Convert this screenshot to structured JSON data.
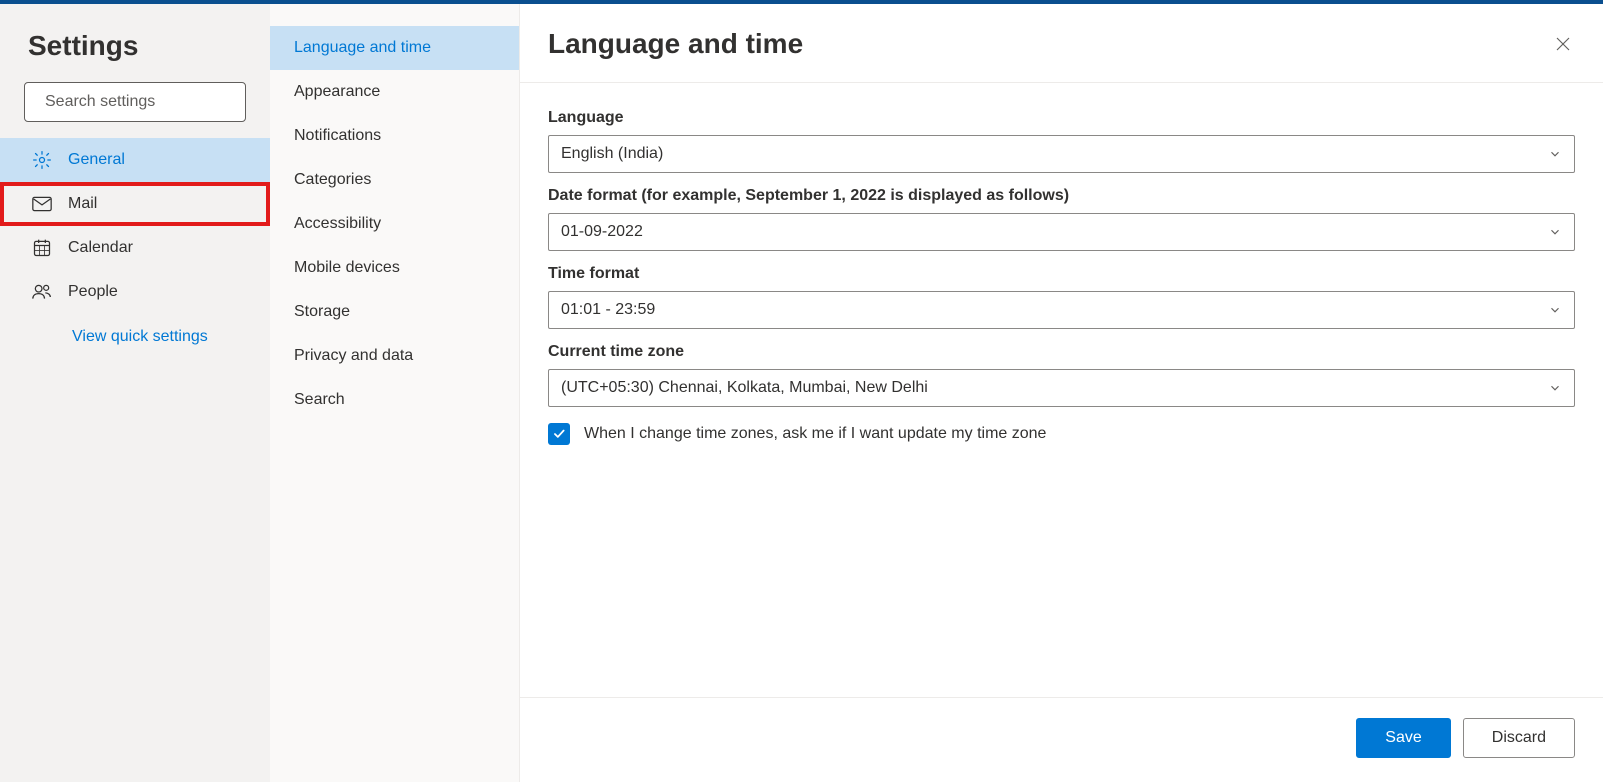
{
  "sidebar": {
    "title": "Settings",
    "search_placeholder": "Search settings",
    "items": [
      {
        "label": "General"
      },
      {
        "label": "Mail"
      },
      {
        "label": "Calendar"
      },
      {
        "label": "People"
      }
    ],
    "quick_link": "View quick settings"
  },
  "sub_sidebar": {
    "items": [
      {
        "label": "Language and time"
      },
      {
        "label": "Appearance"
      },
      {
        "label": "Notifications"
      },
      {
        "label": "Categories"
      },
      {
        "label": "Accessibility"
      },
      {
        "label": "Mobile devices"
      },
      {
        "label": "Storage"
      },
      {
        "label": "Privacy and data"
      },
      {
        "label": "Search"
      }
    ]
  },
  "content": {
    "title": "Language and time",
    "fields": {
      "language": {
        "label": "Language",
        "value": "English (India)"
      },
      "date_format": {
        "label": "Date format (for example, September 1, 2022 is displayed as follows)",
        "value": "01-09-2022"
      },
      "time_format": {
        "label": "Time format",
        "value": "01:01 - 23:59"
      },
      "time_zone": {
        "label": "Current time zone",
        "value": "(UTC+05:30) Chennai, Kolkata, Mumbai, New Delhi"
      },
      "tz_checkbox": {
        "label": "When I change time zones, ask me if I want update my time zone",
        "checked": true
      }
    },
    "buttons": {
      "save": "Save",
      "discard": "Discard"
    }
  }
}
